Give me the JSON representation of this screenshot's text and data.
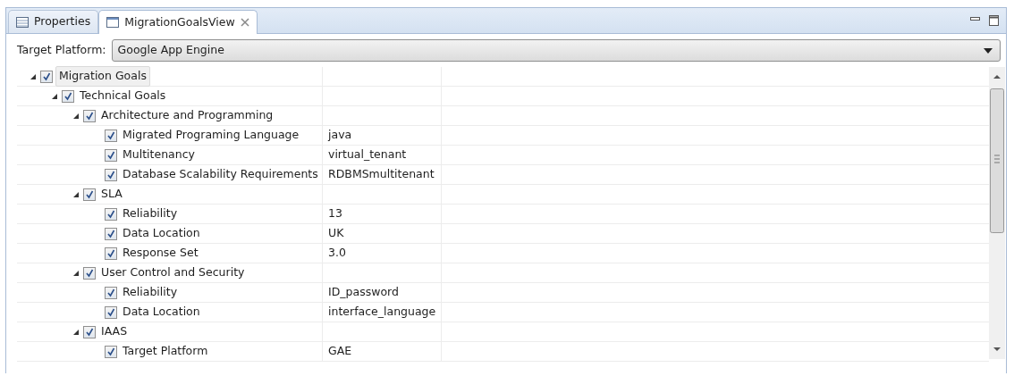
{
  "tabs": [
    {
      "label": "Properties",
      "selected": false,
      "kind": "table"
    },
    {
      "label": "MigrationGoalsView",
      "selected": true,
      "kind": "view"
    }
  ],
  "target_platform": {
    "label": "Target Platform:",
    "value": "Google App Engine"
  },
  "tree": [
    {
      "label": "Migration Goals",
      "checked": true,
      "expanded": true,
      "selected": true,
      "children": [
        {
          "label": "Technical Goals",
          "checked": true,
          "expanded": true,
          "selected": false,
          "children": [
            {
              "label": "Architecture and Programming",
              "checked": true,
              "expanded": true,
              "selected": false,
              "children": [
                {
                  "label": "Migrated Programing Language",
                  "value": "java",
                  "checked": true,
                  "selected": false
                },
                {
                  "label": "Multitenancy",
                  "value": "virtual_tenant",
                  "checked": true,
                  "selected": false
                },
                {
                  "label": "Database Scalability Requirements",
                  "value": "RDBMSmultitenant",
                  "checked": true,
                  "selected": false
                }
              ]
            },
            {
              "label": "SLA",
              "checked": true,
              "expanded": true,
              "selected": false,
              "children": [
                {
                  "label": "Reliability",
                  "value": "13",
                  "checked": true,
                  "selected": false
                },
                {
                  "label": "Data Location",
                  "value": "UK",
                  "checked": true,
                  "selected": false
                },
                {
                  "label": "Response Set",
                  "value": "3.0",
                  "checked": true,
                  "selected": false
                }
              ]
            },
            {
              "label": "User Control and Security",
              "checked": true,
              "expanded": true,
              "selected": false,
              "children": [
                {
                  "label": "Reliability",
                  "value": "ID_password",
                  "checked": true,
                  "selected": false
                },
                {
                  "label": "Data Location",
                  "value": "interface_language",
                  "checked": true,
                  "selected": false
                }
              ]
            },
            {
              "label": "IAAS",
              "checked": true,
              "expanded": true,
              "selected": false,
              "children": [
                {
                  "label": "Target Platform",
                  "value": "GAE",
                  "checked": true,
                  "selected": false
                }
              ]
            }
          ]
        }
      ]
    }
  ]
}
